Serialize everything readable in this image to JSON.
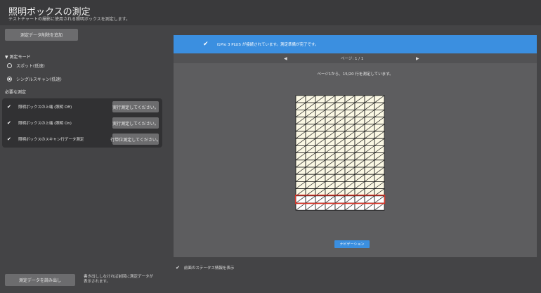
{
  "window": {
    "title": "照明ボックスの測定",
    "subtitle": "テストチャートの撮影に使用される照明ボックスを測定します。"
  },
  "left": {
    "add_button": "測定データ削除を追加",
    "mode_label": "▼ 測定モード",
    "modes": [
      {
        "label": "スポット(低速)",
        "selected": false
      },
      {
        "label": "シングルスキャン(低速)",
        "selected": true
      }
    ],
    "required_label": "必要な測定",
    "required": [
      {
        "check": "✔",
        "text": "照明ボックスの上端 (照明 Off)",
        "button": "実行測定してください。"
      },
      {
        "check": "✔",
        "text": "照明ボックスの上端 (照明 On)",
        "button": "実行測定してください。"
      },
      {
        "check": "✔",
        "text": "照明ボックスのスキャン行データ測定",
        "button": "行単位測定してください。"
      }
    ],
    "load_button": "測定データを読み出し",
    "note": "書き出ししなければ前回に測定データが表示されます。"
  },
  "main": {
    "banner_check": "✔",
    "banner_text": "i1Pro 3 PLUS が接続されています。測定準備が完了です。",
    "pager_prev": "◀",
    "pager_label": "ページ: 1 / 1",
    "pager_next": "▶",
    "status": "ページ1から、15/20 行を測定しています。",
    "grid": {
      "columns": 9,
      "rows": 16,
      "measured_rows": 14,
      "highlight_row": 14
    },
    "nav_button": "ナビゲーション"
  },
  "footer": {
    "checkbox": "✔",
    "checkbox_label": "前面のステータス情報を表示"
  },
  "colors": {
    "accent": "#3b8fe0",
    "highlight_border": "#d9362a",
    "measured_patch": "#fbf8e4",
    "unmeasured_patch": "#ffffff"
  }
}
